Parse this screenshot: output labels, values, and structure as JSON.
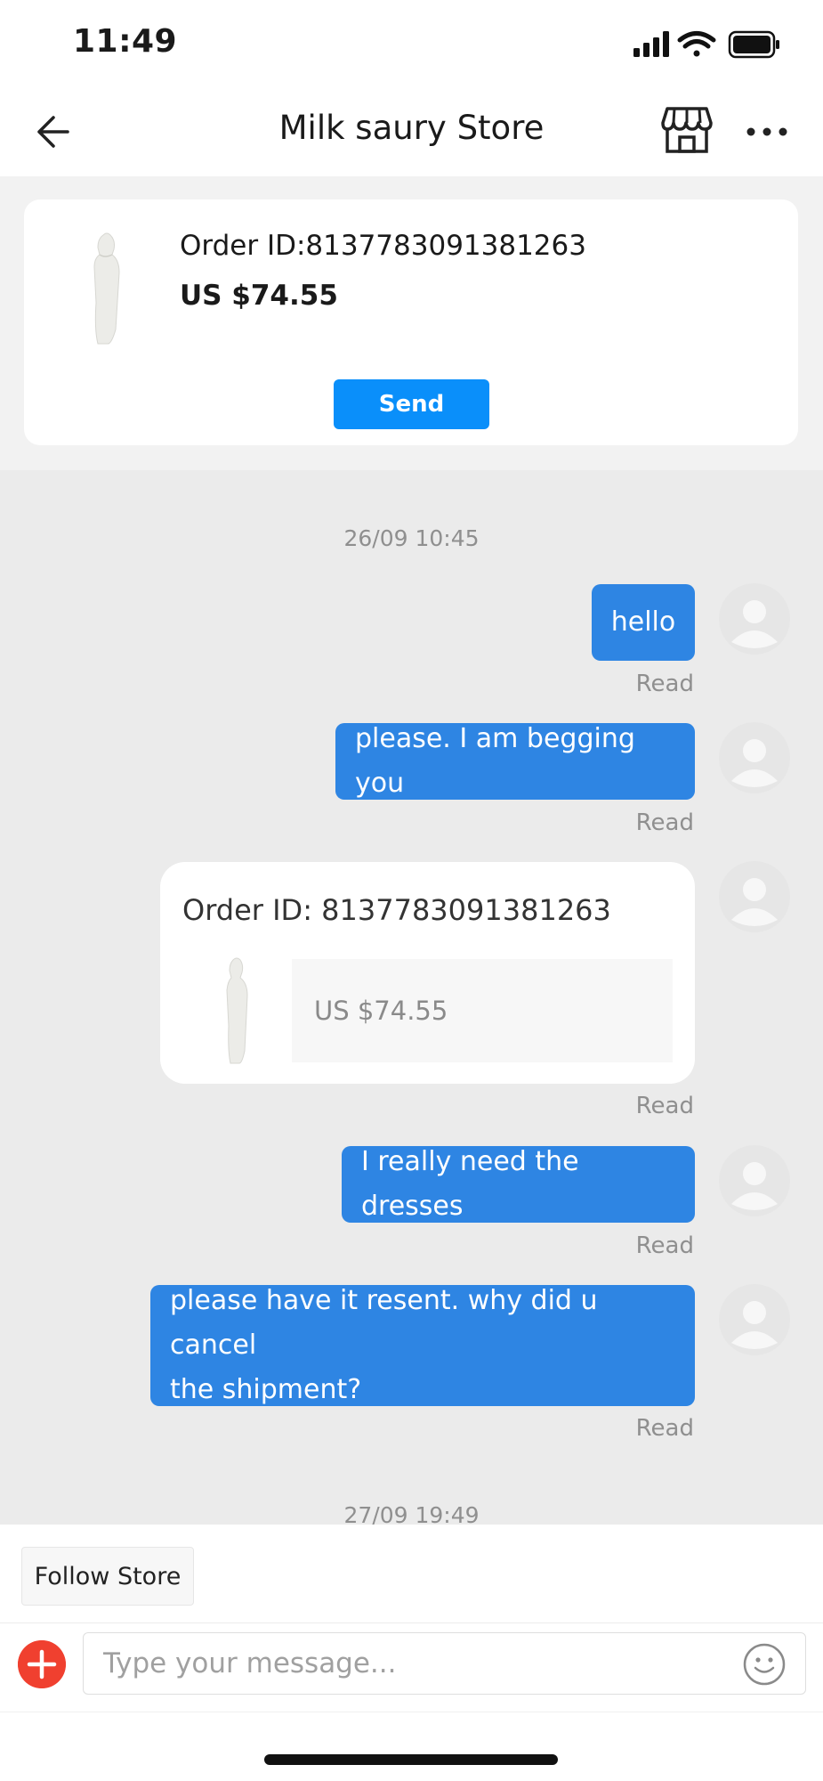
{
  "status_bar": {
    "time": "11:49"
  },
  "nav": {
    "title": "Milk saury Store"
  },
  "order_card": {
    "order_id": "Order ID:8137783091381263",
    "price": "US $74.55",
    "send_label": "Send"
  },
  "chat": {
    "timestamp_1": "26/09 10:45",
    "timestamp_2": "27/09 19:49",
    "read_label": "Read",
    "messages": [
      {
        "text": "hello",
        "status": "Read"
      },
      {
        "text": "please. I am begging you",
        "status": "Read"
      },
      {
        "order_id": "Order ID: 8137783091381263",
        "price": "US $74.55",
        "status": "Read"
      },
      {
        "text": "I really need the dresses",
        "status": "Read"
      },
      {
        "line1": "please have it resent. why did u cancel",
        "line2": "the shipment?",
        "status": "Read"
      }
    ]
  },
  "bottom": {
    "follow_label": "Follow Store",
    "input_placeholder": "Type your message..."
  },
  "colors": {
    "bubble": "#2e85e3",
    "send_button": "#0a8ffa",
    "plus_button": "#f0402f"
  }
}
